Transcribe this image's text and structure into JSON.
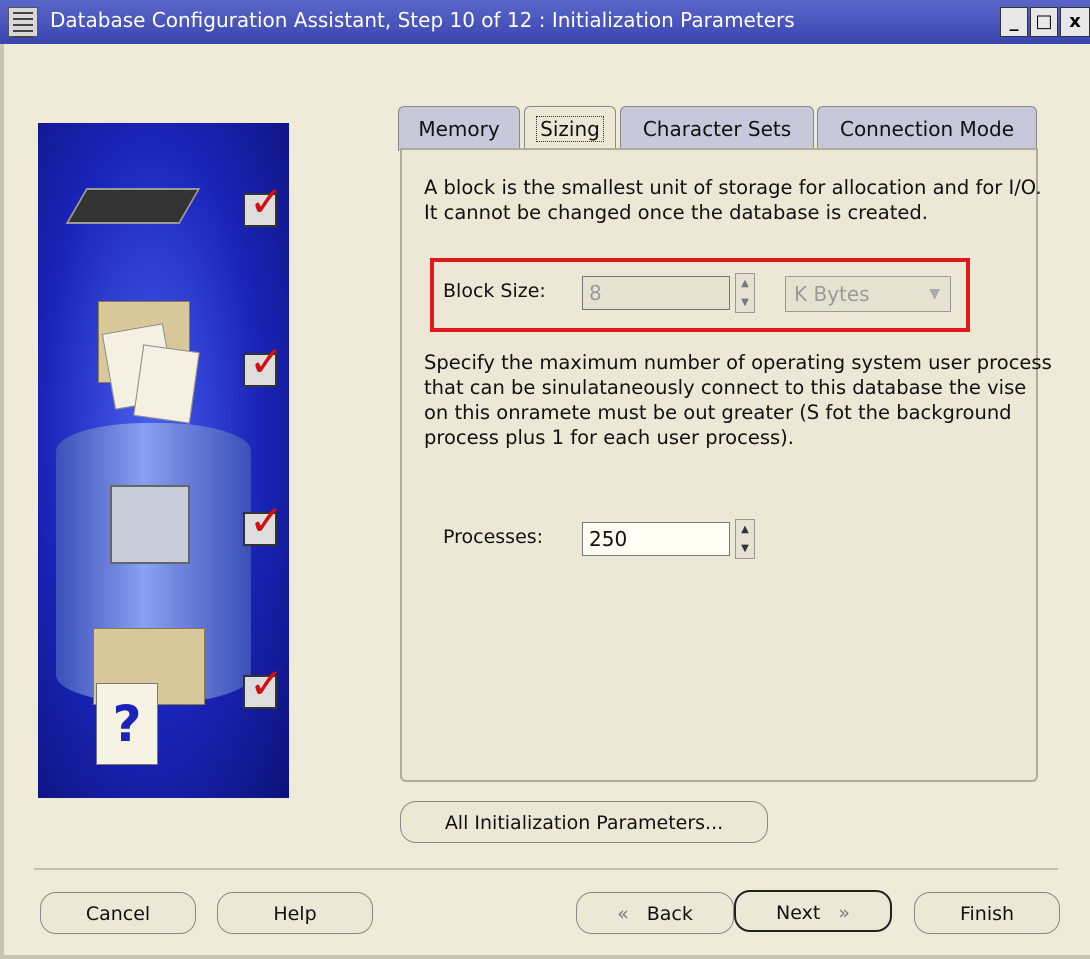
{
  "window": {
    "title": "Database Configuration Assistant, Step 10 of 12 : Initialization Parameters",
    "minimize": "_",
    "maximize": "□",
    "close": "x"
  },
  "tabs": [
    {
      "label": "Memory",
      "active": false
    },
    {
      "label": "Sizing",
      "active": true
    },
    {
      "label": "Character Sets",
      "active": false
    },
    {
      "label": "Connection Mode",
      "active": false
    }
  ],
  "sizing": {
    "block_description": "A block is the smallest unit of storage for allocation and for I/O. It cannot be changed once the database is created.",
    "block_size_label": "Block Size:",
    "block_size_value": "8",
    "block_size_unit": "K Bytes",
    "processes_description": "Specify the maximum number of operating system user process that can be sinulataneously connect to this database the vise on this onramete must be out greater (S fot the background process plus 1 for each user process).",
    "processes_label": "Processes:",
    "processes_value": "250"
  },
  "buttons": {
    "all_params": "All Initialization Parameters...",
    "cancel": "Cancel",
    "help": "Help",
    "back": "Back",
    "next": "Next",
    "finish": "Finish"
  },
  "colors": {
    "titlebar": "#3a46b0",
    "highlight": "#e01818",
    "dialog_bg": "#f0ebd9"
  },
  "icons": {
    "checkmark": "red-check-icon",
    "back_arrow": "«",
    "next_arrow": "»",
    "question": "?"
  }
}
